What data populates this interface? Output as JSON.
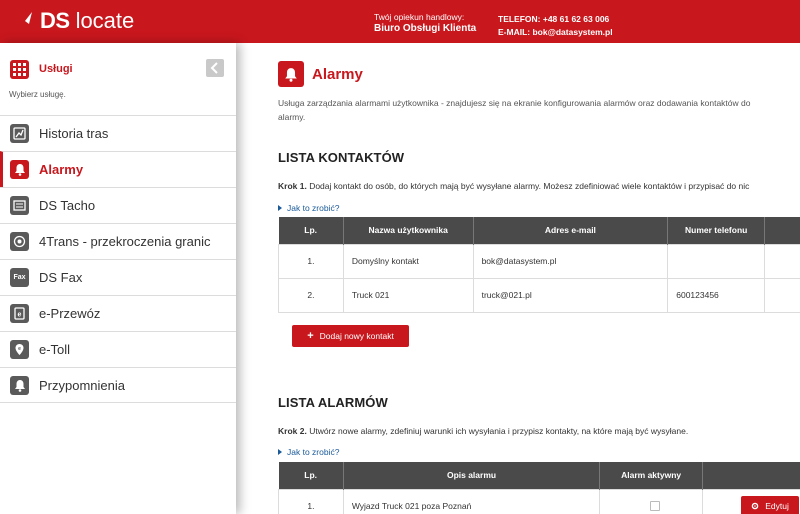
{
  "header": {
    "logo_bold": "DS",
    "logo_light": "locate",
    "opiekun_label": "Twój opiekun handlowy:",
    "opiekun_name": "Biuro Obsługi Klienta",
    "phone_line": "TELEFON: +48 61 62 63 006",
    "email_line": "E-MAIL: bok@datasystem.pl"
  },
  "sidebar": {
    "title": "Usługi",
    "subtitle": "Wybierz usługę.",
    "items": [
      {
        "label": "Historia tras",
        "icon": "map-route-icon"
      },
      {
        "label": "Alarmy",
        "icon": "bell-icon",
        "active": true
      },
      {
        "label": "DS Tacho",
        "icon": "tacho-icon"
      },
      {
        "label": "4Trans - przekroczenia granic",
        "icon": "border-crossing-icon"
      },
      {
        "label": "DS Fax",
        "icon": "fax-icon",
        "icon_text": "Fax"
      },
      {
        "label": "e-Przewóz",
        "icon": "e-transport-icon"
      },
      {
        "label": "e-Toll",
        "icon": "toll-icon"
      },
      {
        "label": "Przypomnienia",
        "icon": "reminder-bell-icon"
      }
    ]
  },
  "main": {
    "title": "Alarmy",
    "description_line1": "Usługa zarządzania alarmami użytkownika - znajdujesz się na ekranie konfigurowania alarmów oraz dodawania kontaktów do",
    "description_line2": "alarmy.",
    "contacts": {
      "heading": "LISTA KONTAKTÓW",
      "step_bold": "Krok 1.",
      "step_text": " Dodaj kontakt do osób, do których mają być wysyłane alarmy. Możesz zdefiniować wiele kontaktów i przypisać do nic",
      "howto": "Jak to zrobić?",
      "columns": [
        "Lp.",
        "Nazwa użytkownika",
        "Adres e-mail",
        "Numer telefonu",
        ""
      ],
      "rows": [
        {
          "lp": "1.",
          "name": "Domyślny kontakt",
          "email": "bok@datasystem.pl",
          "phone": ""
        },
        {
          "lp": "2.",
          "name": "Truck 021",
          "email": "truck@021.pl",
          "phone": "600123456"
        }
      ],
      "add_button": "Dodaj nowy kontakt"
    },
    "alarms": {
      "heading": "LISTA ALARMÓW",
      "step_bold": "Krok 2.",
      "step_text": " Utwórz nowe alarmy, zdefiniuj warunki ich wysyłania i przypisz kontakty, na które mają być wysyłane.",
      "howto": "Jak to zrobić?",
      "columns": [
        "Lp.",
        "Opis alarmu",
        "Alarm aktywny",
        ""
      ],
      "rows": [
        {
          "lp": "1.",
          "description": "Wyjazd Truck 021 poza Poznań",
          "edit": "Edytuj"
        }
      ]
    }
  },
  "colors": {
    "brand_red": "#c8171d",
    "table_header": "#4a4a4a",
    "link_blue": "#1a5a9a"
  }
}
